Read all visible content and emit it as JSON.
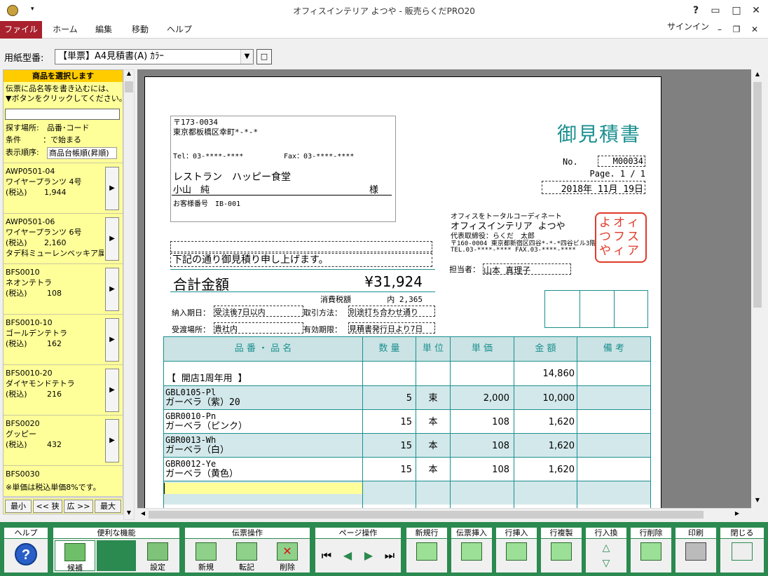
{
  "window": {
    "title": "オフィスインテリア よつや - 販売らくだPRO20",
    "help": "?",
    "signin": "サインイン"
  },
  "tabs": [
    "ファイル",
    "ホーム",
    "編集",
    "移動",
    "ヘルプ"
  ],
  "paper_type": {
    "label": "用紙型番:",
    "value": "【単票】A4見積書(A) ｶﾗｰ",
    "btn": "□"
  },
  "left": {
    "header": "商品を選択します",
    "help1": "伝票に品名等を書き込むには、",
    "help2": "▼ボタンをクリックしてください。",
    "search_place_label": "探す場所:",
    "search_place_value": "品番･コード",
    "condition_label": "条件",
    "condition_value": "：で始まる",
    "order_label": "表示順序:",
    "order_value": "商品台帳順(昇順)",
    "products": [
      {
        "code": "AWP0501-04",
        "name": "ワイヤープランツ  4号",
        "tax": "(税込)",
        "price": "1,944",
        "extra": ""
      },
      {
        "code": "AWP0501-06",
        "name": "ワイヤープランツ  6号",
        "tax": "(税込)",
        "price": "2,160",
        "extra": "タデ科ミューレンベッキア属"
      },
      {
        "code": "BFS0010",
        "name": "ネオンテトラ",
        "tax": "(税込)",
        "price": "108",
        "extra": ""
      },
      {
        "code": "BFS0010-10",
        "name": "ゴールデンテトラ",
        "tax": "(税込)",
        "price": "162",
        "extra": ""
      },
      {
        "code": "BFS0010-20",
        "name": "ダイヤモンドテトラ",
        "tax": "(税込)",
        "price": "216",
        "extra": ""
      },
      {
        "code": "BFS0020",
        "name": "グッピー",
        "tax": "(税込)",
        "price": "432",
        "extra": ""
      },
      {
        "code": "BFS0030",
        "name": "",
        "tax": "",
        "price": "",
        "extra": ""
      }
    ],
    "note": "※単価は税込単価8%です。",
    "nav": [
      "最小",
      "<< 狭",
      "広 >>",
      "最大"
    ]
  },
  "doc": {
    "title": "御見積書",
    "zip": "〒173-0034",
    "address": "東京都板橋区幸町*-*-*",
    "tel": "Tel：03-****-****",
    "fax": "Fax：03-****-****",
    "customer": "レストラン　ハッピー食堂",
    "person": "小山　純",
    "sama": "様",
    "customer_no": "お客様番号　IB-001",
    "no_label": "No.",
    "no_value": "M00034",
    "page": "Page. 1 / 1",
    "date": "2018年 11月 19日",
    "company_tag": "オフィスをトータルコーディネート",
    "company": "オフィスインテリア よつや",
    "rep": "代表取締役：らくだ　太郎",
    "company_addr": "〒160-0004  東京都新宿区四谷*-*-*四谷ビル3階",
    "company_tel": "TEL.03-****-****    FAX.03-****-****",
    "seal": "よオつフやィイスンアテ",
    "staff_label": "担当者：",
    "staff": "山本 真理子",
    "intro": "下記の通り御見積り申し上げます。",
    "total_label": "合計金額",
    "total": "¥31,924",
    "tax_label": "消費税額",
    "tax_value": "内 2,365",
    "delivery_label": "納入期日：",
    "delivery": "受注後7日以内",
    "payment_label": "取引方法：",
    "payment": "別途打ち合わせ通り",
    "place_label": "受渡場所：",
    "place": "貴社内",
    "valid_label": "有効期限：",
    "valid": "見積書発行日より7日",
    "columns": [
      "品 番 ・ 品 名",
      "数 量",
      "単 位",
      "単 価",
      "金 額",
      "備 考"
    ],
    "rows": [
      {
        "code": "",
        "name": "【 開店1周年用 】",
        "qty": "",
        "unit": "",
        "price": "",
        "amount": "14,860"
      },
      {
        "code": "GBL0105-Pl",
        "name": "ガーベラ（紫）20",
        "qty": "5",
        "unit": "束",
        "price": "2,000",
        "amount": "10,000"
      },
      {
        "code": "GBR0010-Pn",
        "name": "ガーベラ（ピンク）",
        "qty": "15",
        "unit": "本",
        "price": "108",
        "amount": "1,620"
      },
      {
        "code": "GBR0013-Wh",
        "name": "ガーベラ（白）",
        "qty": "15",
        "unit": "本",
        "price": "108",
        "amount": "1,620"
      },
      {
        "code": "GBR0012-Ye",
        "name": "ガーベラ（黄色）",
        "qty": "15",
        "unit": "本",
        "price": "108",
        "amount": "1,620"
      }
    ]
  },
  "toolbar": {
    "groups": [
      "ヘルプ",
      "便利な機能",
      "伝票操作",
      "ページ操作",
      "新規行",
      "伝票挿入",
      "行挿入",
      "行複製",
      "行入換",
      "行削除",
      "印刷",
      "閉じる"
    ],
    "buttons": {
      "candidate": "候補",
      "settings": "設定",
      "new": "新規",
      "transfer": "転記",
      "delete": "削除"
    }
  },
  "colors": {
    "file_tab": "#a8212d",
    "toolbar": "#2b8a4f",
    "panel": "#ffff99",
    "teal": "#1b8f8f",
    "seal": "#e03a2a"
  }
}
